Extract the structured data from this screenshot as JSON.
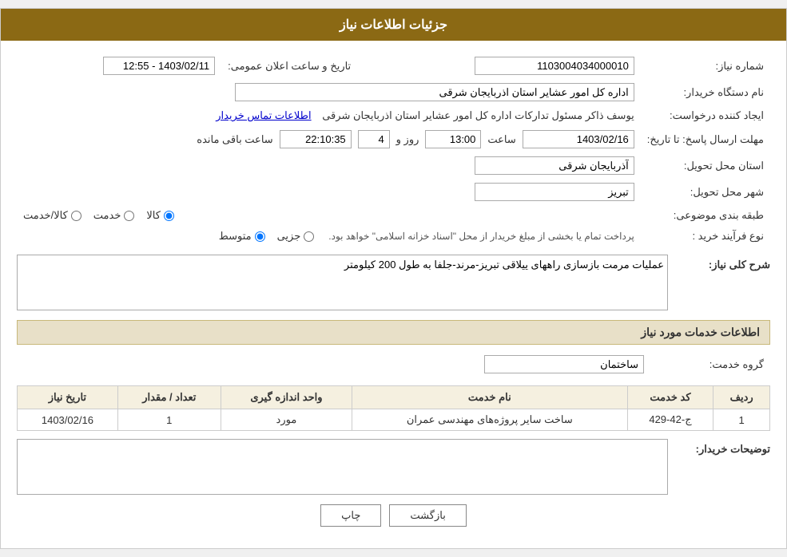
{
  "header": {
    "title": "جزئیات اطلاعات نیاز"
  },
  "fields": {
    "shomara_niaz_label": "شماره نیاز:",
    "shomara_niaz_value": "1103004034000010",
    "naam_dastgah_label": "نام دستگاه خریدار:",
    "naam_dastgah_value": "اداره کل امور عشایر استان اذربایجان شرقی",
    "ijad_konande_label": "ایجاد کننده درخواست:",
    "ijad_konande_value": "یوسف ذاکر مسئول تدارکات اداره کل امور عشایر استان اذربایجان شرقی",
    "contact_link": "اطلاعات تماس خریدار",
    "mohlat_label": "مهلت ارسال پاسخ: تا تاریخ:",
    "mohlat_date": "1403/02/16",
    "mohlat_saat": "13:00",
    "mohlat_roz": "4",
    "mohlat_time_remain": "22:10:35",
    "mohlat_suffix": "ساعت باقی مانده",
    "roz_label": "روز و",
    "saat_label": "ساعت",
    "ostan_label": "استان محل تحویل:",
    "ostan_value": "آذربایجان شرقی",
    "shahr_label": "شهر محل تحویل:",
    "shahr_value": "تبریز",
    "tabagheh_label": "طبقه بندی موضوعی:",
    "tabagheh_options": [
      "کالا",
      "خدمت",
      "کالا/خدمت"
    ],
    "tabagheh_selected": "کالا",
    "nooe_farayand_label": "نوع فرآیند خرید :",
    "nooe_options": [
      "جزیی",
      "متوسط"
    ],
    "nooe_selected": "متوسط",
    "nooe_note": "پرداخت تمام یا بخشی از مبلغ خریدار از محل \"اسناد خزانه اسلامی\" خواهد بود.",
    "tarikh_label": "تاریخ و ساعت اعلان عمومی:",
    "tarikh_value": "1403/02/11 - 12:55",
    "sharh_label": "شرح کلی نیاز:",
    "sharh_value": "عملیات مرمت بازسازی راههای ییلاقی تبریز-مرند-جلفا به طول 200 کیلومتر",
    "khadamat_section": "اطلاعات خدمات مورد نیاز",
    "goroh_khadamat_label": "گروه خدمت:",
    "goroh_khadamat_value": "ساختمان",
    "table": {
      "headers": [
        "ردیف",
        "کد خدمت",
        "نام خدمت",
        "واحد اندازه گیری",
        "تعداد / مقدار",
        "تاریخ نیاز"
      ],
      "rows": [
        {
          "radif": "1",
          "code": "ج-42-429",
          "name": "ساخت سایر پروژه‌های مهندسی عمران",
          "vahed": "مورد",
          "tedad": "1",
          "tarikh": "1403/02/16"
        }
      ]
    },
    "tozihat_label": "توضیحات خریدار:",
    "tozihat_value": ""
  },
  "buttons": {
    "print": "چاپ",
    "back": "بازگشت"
  }
}
